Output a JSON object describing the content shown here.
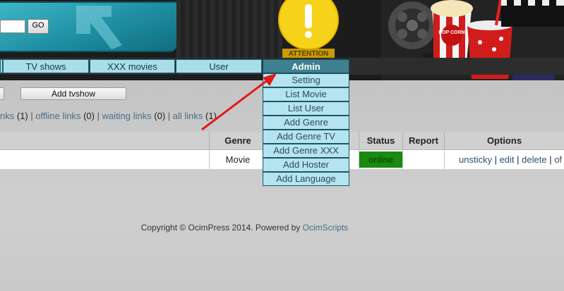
{
  "header": {
    "search_value": "",
    "go_label": "GO",
    "attention_label": "ATTENTION",
    "popcorn_label": "POP CORN"
  },
  "nav": {
    "items": [
      {
        "label": "TV shows"
      },
      {
        "label": "XXX movies"
      },
      {
        "label": "User"
      }
    ]
  },
  "admin_menu": {
    "label": "Admin",
    "items": [
      {
        "label": "Setting"
      },
      {
        "label": "List Movie"
      },
      {
        "label": "List User"
      },
      {
        "label": "Add Genre"
      },
      {
        "label": "Add Genre TV"
      },
      {
        "label": "Add Genre XXX"
      },
      {
        "label": "Add Hoster"
      },
      {
        "label": "Add Language"
      }
    ]
  },
  "toolbar": {
    "add_tvshow_label": "Add tvshow"
  },
  "links_summary": {
    "online_label": "nks",
    "online_count": "(1)",
    "sep1": " | ",
    "offline_label": "offline links",
    "offline_count": "(0)",
    "sep2": " | ",
    "waiting_label": "waiting links",
    "waiting_count": "(0)",
    "sep3": " | ",
    "all_label": "all links",
    "all_count": "(1)"
  },
  "table": {
    "headers": {
      "genre": "Genre",
      "status": "Status",
      "report": "Report",
      "options": "Options"
    },
    "rows": [
      {
        "genre": "Movie",
        "status": "online",
        "report": "",
        "options": [
          "unsticky",
          "edit",
          "delete",
          "of"
        ]
      }
    ],
    "option_sep": " | "
  },
  "footer": {
    "text": "Copyright © OcimPress 2014. Powered by ",
    "brand": "OcimScripts"
  },
  "colors": {
    "nav_bg": "#a9dde8",
    "admin_bg": "#3e8090",
    "status_online": "#1a8a12",
    "arrow": "#e11b1b"
  }
}
